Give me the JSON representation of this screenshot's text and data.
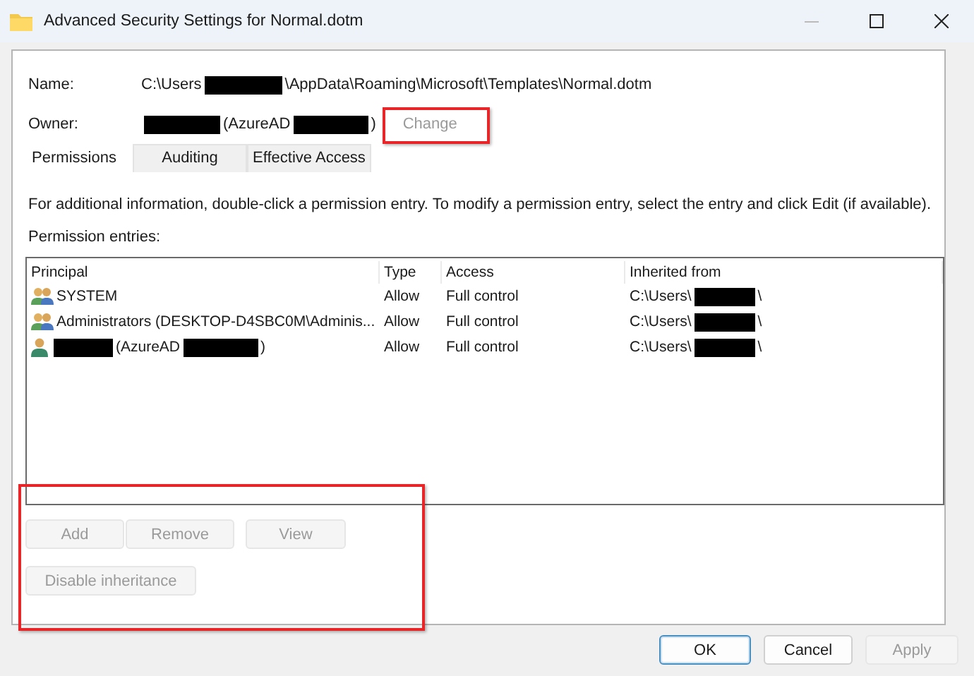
{
  "window": {
    "title": "Advanced Security Settings for Normal.dotm"
  },
  "name": {
    "label": "Name:",
    "value": [
      {
        "kind": "text",
        "text": "C:\\Users"
      },
      {
        "kind": "redacted"
      },
      {
        "kind": "text",
        "text": "\\AppData\\Roaming\\Microsoft\\Templates\\Normal.dotm"
      }
    ]
  },
  "owner": {
    "label": "Owner:",
    "value": [
      {
        "kind": "redacted"
      },
      {
        "kind": "text",
        "text": "(AzureAD"
      },
      {
        "kind": "redacted"
      },
      {
        "kind": "text",
        "text": ")"
      }
    ],
    "change": {
      "label": "Change",
      "disabled": true,
      "highlighted": true
    }
  },
  "tabs": [
    {
      "label": "Permissions",
      "selected": true
    },
    {
      "label": "Auditing",
      "selected": false
    },
    {
      "label": "Effective Access",
      "selected": false
    }
  ],
  "info": "For additional information, double-click a permission entry. To modify a permission entry, select the entry and click Edit (if available).",
  "entries_label": "Permission entries:",
  "table": {
    "columns": [
      "Principal",
      "Type",
      "Access",
      "Inherited from"
    ],
    "rows": [
      {
        "kind": "group",
        "principal": [
          {
            "kind": "text",
            "text": "SYSTEM"
          }
        ],
        "type": "Allow",
        "access": "Full control",
        "inherited_from": [
          {
            "kind": "text",
            "text": "C:\\Users\\"
          },
          {
            "kind": "redacted"
          },
          {
            "kind": "text",
            "text": "\\"
          }
        ]
      },
      {
        "kind": "group",
        "principal": [
          {
            "kind": "text",
            "text": "Administrators (DESKTOP-D4SBC0M\\Adminis..."
          }
        ],
        "type": "Allow",
        "access": "Full control",
        "inherited_from": [
          {
            "kind": "text",
            "text": "C:\\Users\\"
          },
          {
            "kind": "redacted"
          },
          {
            "kind": "text",
            "text": "\\"
          }
        ]
      },
      {
        "kind": "user",
        "principal": [
          {
            "kind": "redacted"
          },
          {
            "kind": "text",
            "text": "(AzureAD"
          },
          {
            "kind": "redacted"
          },
          {
            "kind": "text",
            "text": ")"
          }
        ],
        "type": "Allow",
        "access": "Full control",
        "inherited_from": [
          {
            "kind": "text",
            "text": "C:\\Users\\"
          },
          {
            "kind": "redacted"
          },
          {
            "kind": "text",
            "text": "\\"
          }
        ]
      }
    ]
  },
  "actions": {
    "highlighted": true,
    "buttons": [
      {
        "label": "Add",
        "disabled": true
      },
      {
        "label": "Remove",
        "disabled": true
      },
      {
        "label": "View",
        "disabled": true
      }
    ],
    "inheritance_button": {
      "label": "Disable inheritance",
      "disabled": true
    }
  },
  "footer_buttons": [
    {
      "label": "OK",
      "default": true,
      "disabled": false
    },
    {
      "label": "Cancel",
      "default": false,
      "disabled": false
    },
    {
      "label": "Apply",
      "default": false,
      "disabled": true
    }
  ]
}
